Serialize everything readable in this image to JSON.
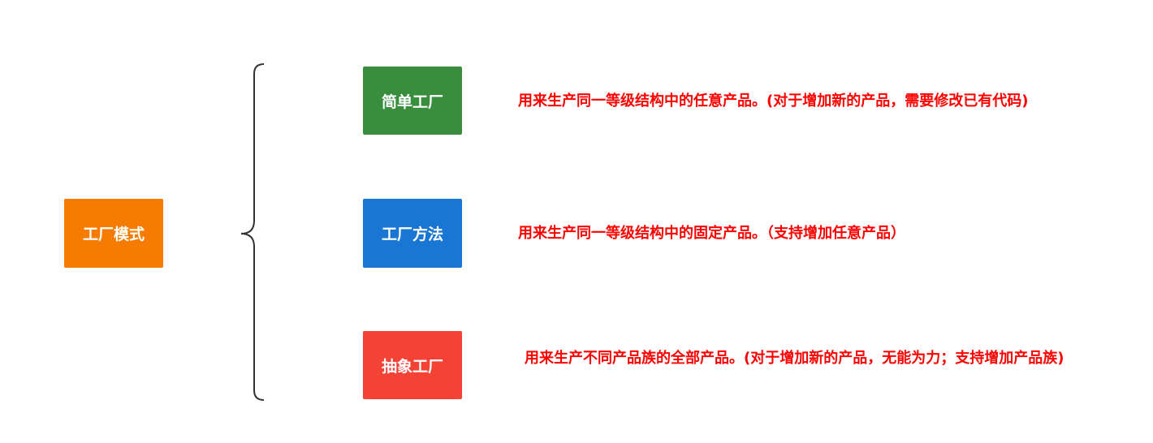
{
  "root": {
    "label": "工厂模式",
    "color": "#F57C00"
  },
  "branches": [
    {
      "label": "简单工厂",
      "color": "#388E3C",
      "description": "用来生产同一等级结构中的任意产品。(对于增加新的产品，需要修改已有代码)"
    },
    {
      "label": "工厂方法",
      "color": "#1976D2",
      "description": "用来生产同一等级结构中的固定产品。（支持增加任意产品）"
    },
    {
      "label": "抽象工厂",
      "color": "#F44336",
      "description": "用来生产不同产品族的全部产品。(对于增加新的产品，无能为力；支持增加产品族)"
    }
  ],
  "description_color": "#FF0000",
  "brace_color": "#333333"
}
